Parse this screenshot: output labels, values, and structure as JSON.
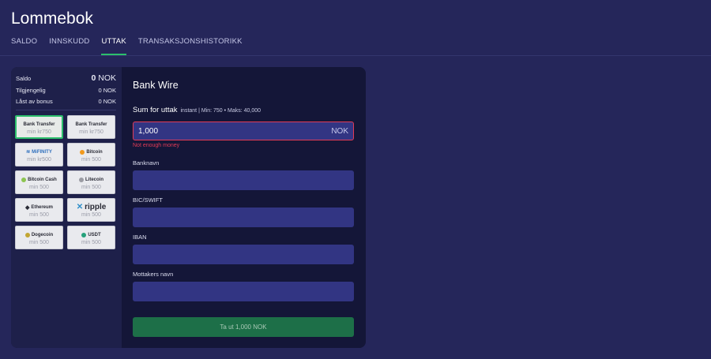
{
  "page": {
    "title": "Lommebok"
  },
  "tabs": [
    {
      "label": "SALDO",
      "active": false
    },
    {
      "label": "INNSKUDD",
      "active": false
    },
    {
      "label": "UTTAK",
      "active": true
    },
    {
      "label": "TRANSAKSJONSHISTORIKK",
      "active": false
    }
  ],
  "balances": {
    "saldo_label": "Saldo",
    "saldo_amount": "0",
    "saldo_currency": "NOK",
    "available_label": "Tilgjengelig",
    "available_value": "0 NOK",
    "locked_label": "Låst av bonus",
    "locked_value": "0 NOK"
  },
  "methods": [
    {
      "logo": "Bank Transfer",
      "min": "min kr750",
      "active": true
    },
    {
      "logo": "Bank Transfer",
      "min": "min kr750",
      "active": false
    },
    {
      "logo": "MiFINITY",
      "min": "min kr500",
      "active": false
    },
    {
      "logo": "Bitcoin",
      "min": "min 500",
      "active": false
    },
    {
      "logo": "Bitcoin Cash",
      "min": "min 500",
      "active": false
    },
    {
      "logo": "Litecoin",
      "min": "min 500",
      "active": false
    },
    {
      "logo": "Ethereum",
      "min": "min 500",
      "active": false
    },
    {
      "logo": "ripple",
      "min": "min 500",
      "active": false
    },
    {
      "logo": "Dogecoin",
      "min": "min 500",
      "active": false
    },
    {
      "logo": "USDT",
      "min": "min 500",
      "active": false
    }
  ],
  "withdraw": {
    "heading": "Bank Wire",
    "sum_label": "Sum for uttak",
    "sum_hint": "instant | Min: 750 • Maks: 40,000",
    "amount_value": "1,000",
    "amount_currency": "NOK",
    "error": "Not enough money",
    "fields": [
      {
        "label": "Banknavn",
        "value": ""
      },
      {
        "label": "BIC/SWIFT",
        "value": ""
      },
      {
        "label": "IBAN",
        "value": ""
      },
      {
        "label": "Mottakers navn",
        "value": ""
      }
    ],
    "submit_label": "Ta ut 1,000 NOK"
  },
  "colors": {
    "background": "#25265a",
    "card": "#141638",
    "panel": "#1e204a",
    "input": "#323583",
    "accent_green": "#2cbf6c",
    "error_red": "#e23b56",
    "button": "#1d6f48"
  }
}
